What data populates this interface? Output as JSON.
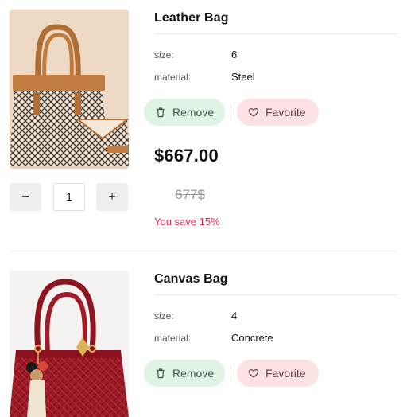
{
  "items": [
    {
      "title": "Leather Bag",
      "attributes": [
        {
          "label": "size:",
          "value": "6"
        },
        {
          "label": "material:",
          "value": "Steel"
        }
      ],
      "remove_label": "Remove",
      "favorite_label": "Favorite",
      "price": "$667.00",
      "old_price": "677$",
      "save_text": "You save 15%",
      "quantity": "1",
      "minus_label": "−",
      "plus_label": "+"
    },
    {
      "title": "Canvas Bag",
      "attributes": [
        {
          "label": "size:",
          "value": "4"
        },
        {
          "label": "material:",
          "value": "Concrete"
        }
      ],
      "remove_label": "Remove",
      "favorite_label": "Favorite"
    }
  ],
  "colors": {
    "remove_bg": "#dff3e4",
    "favorite_bg": "#fde2e4",
    "save_text": "#e0314b"
  },
  "icons": {
    "remove": "trash-icon",
    "favorite": "heart-icon"
  }
}
